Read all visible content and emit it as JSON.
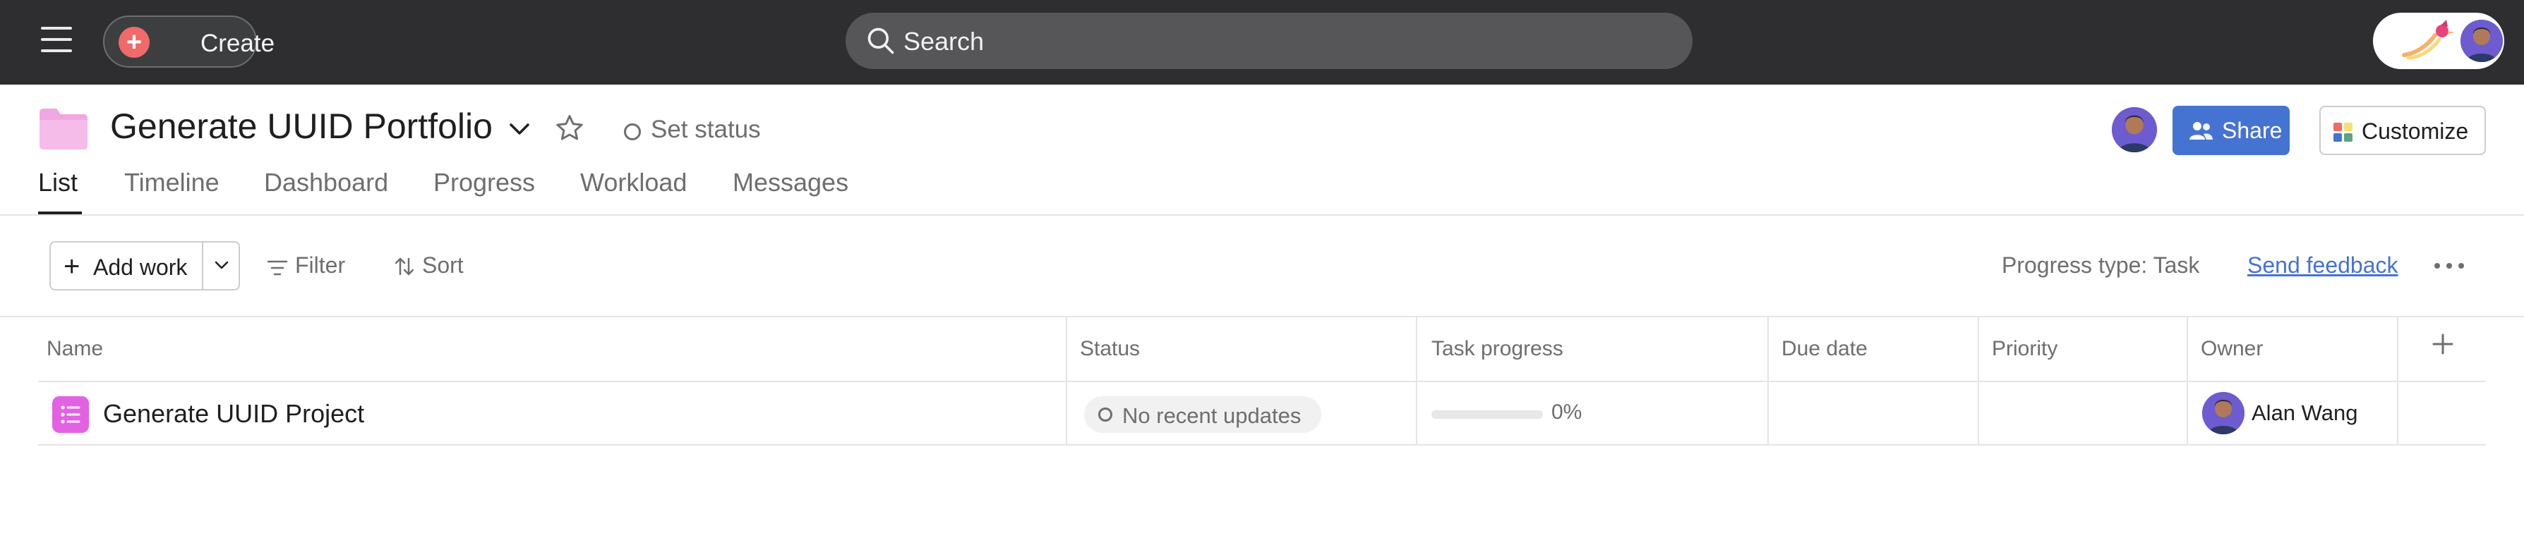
{
  "topbar": {
    "create_label": "Create",
    "search_placeholder": "Search"
  },
  "header": {
    "portfolio_title": "Generate UUID Portfolio",
    "set_status_label": "Set status",
    "share_label": "Share",
    "customize_label": "Customize"
  },
  "tabs": [
    {
      "label": "List",
      "active": true
    },
    {
      "label": "Timeline"
    },
    {
      "label": "Dashboard"
    },
    {
      "label": "Progress"
    },
    {
      "label": "Workload"
    },
    {
      "label": "Messages"
    }
  ],
  "toolbar": {
    "add_work_label": "Add work",
    "filter_label": "Filter",
    "sort_label": "Sort",
    "progress_type_label": "Progress type: Task",
    "send_feedback_label": "Send feedback"
  },
  "table": {
    "columns": [
      "Name",
      "Status",
      "Task progress",
      "Due date",
      "Priority",
      "Owner"
    ],
    "rows": [
      {
        "name": "Generate UUID Project",
        "status": "No recent updates",
        "progress": 0,
        "progress_label": "0%",
        "due_date": "",
        "priority": "",
        "owner": "Alan Wang"
      }
    ]
  },
  "colors": {
    "topbar_bg": "#2e2e30",
    "create_accent": "#f06a6a",
    "share_blue": "#4573d2",
    "folder_pink": "#f1a7e2",
    "project_icon": "#e362e3"
  },
  "icons": {
    "menu": "hamburger-icon",
    "create": "plus-circle-icon",
    "search": "search-icon",
    "folder": "folder-icon",
    "favorite": "star-icon",
    "share": "people-icon",
    "customize": "grid-icon",
    "filter": "filter-icon",
    "sort": "sort-icon",
    "more": "more-horizontal-icon",
    "add_column": "plus-icon",
    "project": "list-icon"
  }
}
